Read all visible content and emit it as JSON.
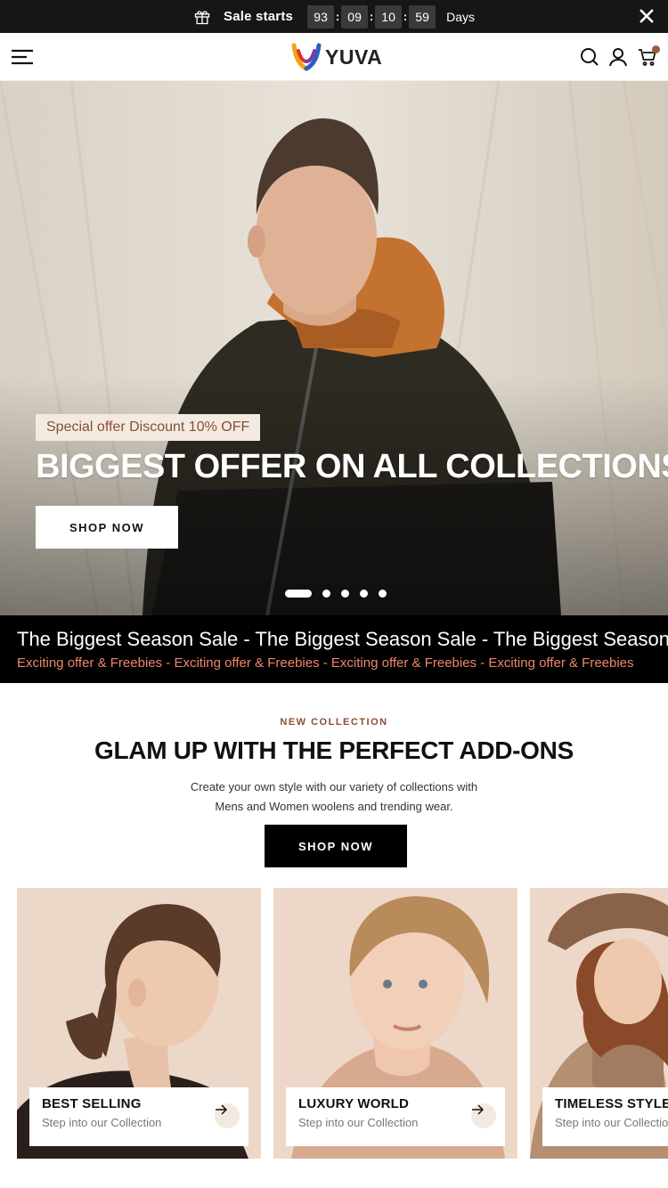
{
  "announcement": {
    "label": "Sale starts",
    "countdown": [
      "93",
      "09",
      "10",
      "59"
    ],
    "separator": ":",
    "unit": "Days"
  },
  "header": {
    "logo_text": "YUVA"
  },
  "hero": {
    "tag": "Special offer Discount 10% OFF",
    "title": "BIGGEST OFFER ON ALL COLLECTIONS",
    "button": "SHOP NOW",
    "slides": 5,
    "active_slide": 1
  },
  "marquee": {
    "line1": "The Biggest Season Sale - The Biggest Season Sale - The Biggest Season Sale",
    "line2": "Exciting offer & Freebies - Exciting offer & Freebies - Exciting offer & Freebies - Exciting offer & Freebies"
  },
  "collection": {
    "eyebrow": "NEW COLLECTION",
    "title": "GLAM UP WITH THE PERFECT ADD-ONS",
    "desc_line1": "Create your own style with our variety of collections with",
    "desc_line2": "Mens and Women woolens and trending wear.",
    "button": "SHOP NOW"
  },
  "cards": [
    {
      "title": "BEST SELLING",
      "subtitle": "Step into our Collection"
    },
    {
      "title": "LUXURY WORLD",
      "subtitle": "Step into our Collection"
    },
    {
      "title": "TIMELESS STYLE",
      "subtitle": "Step into our Collection"
    }
  ],
  "colors": {
    "accent": "#8a4e33",
    "marquee_sub": "#f0866a",
    "announce_bg": "#161616"
  },
  "icons": [
    "gift-icon",
    "close-icon",
    "menu-icon",
    "search-icon",
    "account-icon",
    "cart-icon",
    "arrow-right-icon"
  ]
}
